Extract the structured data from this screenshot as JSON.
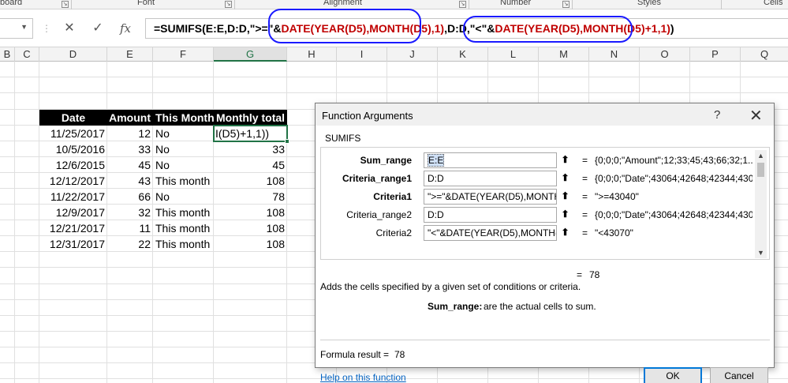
{
  "ribbon": {
    "groups": [
      {
        "label": "board"
      },
      {
        "label": "Font"
      },
      {
        "label": "Alignment"
      },
      {
        "label": "Number"
      },
      {
        "label": "Styles"
      },
      {
        "label": "Cells"
      }
    ]
  },
  "formula_bar": {
    "cancel_glyph": "✕",
    "enter_glyph": "✓",
    "fx_glyph": "fx",
    "formula_part1": "=SUMIFS(E:E,D:D,\">=\"&",
    "formula_part2": "DATE(YEAR(D5),MONTH(D5),1)",
    "formula_part3": ",D:D,\"<\"&",
    "formula_part4": "DATE(YEAR(D5),MONTH(D5)+1,1)",
    "formula_part5": ")"
  },
  "columns": [
    "B",
    "C",
    "D",
    "E",
    "F",
    "G",
    "H",
    "I",
    "J",
    "K",
    "L",
    "M",
    "N",
    "O",
    "P",
    "Q"
  ],
  "table": {
    "headers": [
      "Date",
      "Amount",
      "This Month",
      "Monthly total"
    ],
    "active_cell_text": "I(D5)+1,1))",
    "rows": [
      {
        "date": "11/25/2017",
        "amount": "12",
        "this_month": "No",
        "monthly_total": ""
      },
      {
        "date": "10/5/2016",
        "amount": "33",
        "this_month": "No",
        "monthly_total": "33"
      },
      {
        "date": "12/6/2015",
        "amount": "45",
        "this_month": "No",
        "monthly_total": "45"
      },
      {
        "date": "12/12/2017",
        "amount": "43",
        "this_month": "This month",
        "monthly_total": "108"
      },
      {
        "date": "11/22/2017",
        "amount": "66",
        "this_month": "No",
        "monthly_total": "78"
      },
      {
        "date": "12/9/2017",
        "amount": "32",
        "this_month": "This month",
        "monthly_total": "108"
      },
      {
        "date": "12/21/2017",
        "amount": "11",
        "this_month": "This month",
        "monthly_total": "108"
      },
      {
        "date": "12/31/2017",
        "amount": "22",
        "this_month": "This month",
        "monthly_total": "108"
      }
    ]
  },
  "dialog": {
    "title": "Function Arguments",
    "help_glyph": "?",
    "close_glyph": "✕",
    "function_name": "SUMIFS",
    "args": [
      {
        "label": "Sum_range",
        "value": "E:E",
        "result": "{0;0;0;\"Amount\";12;33;45;43;66;32;1..."
      },
      {
        "label": "Criteria_range1",
        "value": "D:D",
        "result": "{0;0;0;\"Date\";43064;42648;42344;430..."
      },
      {
        "label": "Criteria1",
        "value": "\">=\"&DATE(YEAR(D5),MONTH(D",
        "result": "\">=43040\""
      },
      {
        "label": "Criteria_range2",
        "value": "D:D",
        "result": "{0;0;0;\"Date\";43064;42648;42344;430..."
      },
      {
        "label": "Criteria2",
        "value": "\"<\"&DATE(YEAR(D5),MONTH(D5",
        "result": "\"<43070\""
      }
    ],
    "ref_glyph": "⬆",
    "equals": "=",
    "result": "78",
    "description": "Adds the cells specified by a given set of conditions or criteria.",
    "arg_desc_name": "Sum_range:",
    "arg_desc_text": "are the actual cells to sum.",
    "formula_result_label": "Formula result =",
    "formula_result_value": "78",
    "help_link": "Help on this function",
    "ok_label": "OK",
    "cancel_label": "Cancel",
    "scroll_up": "▲",
    "scroll_down": "▼"
  }
}
